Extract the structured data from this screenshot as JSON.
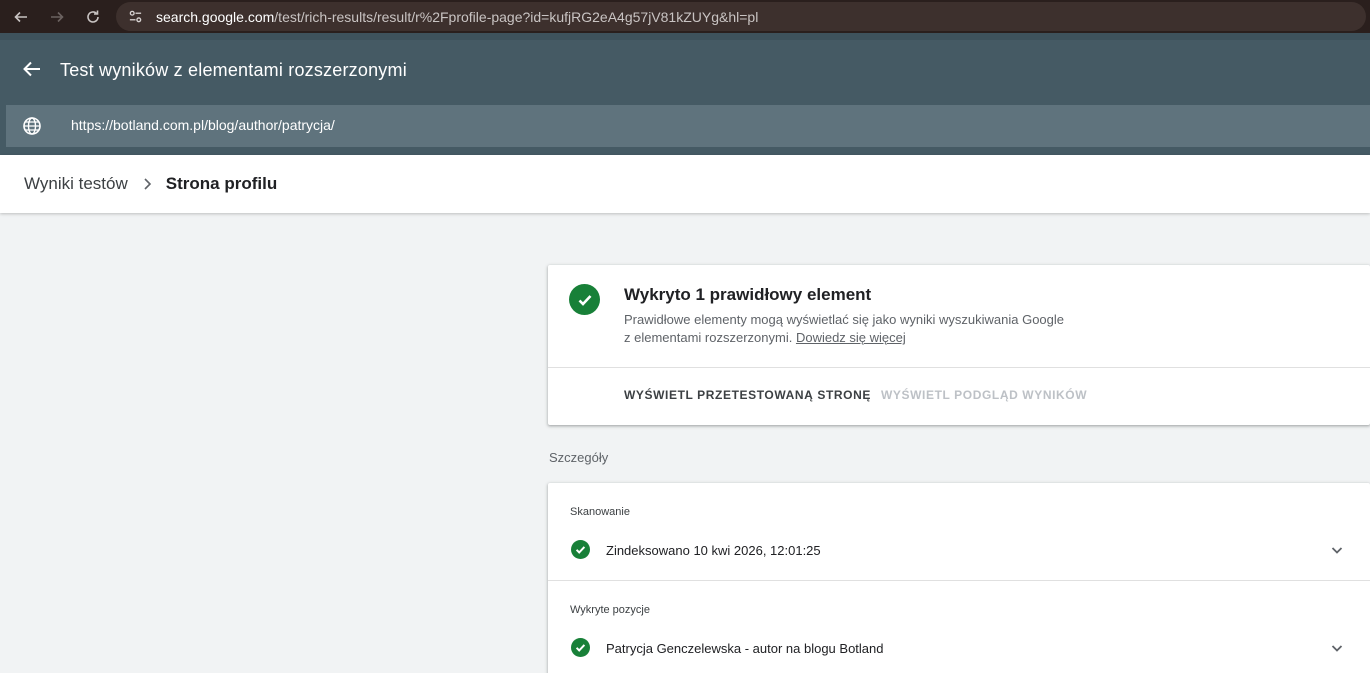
{
  "browser": {
    "url_host": "search.google.com",
    "url_path": "/test/rich-results/result/r%2Fprofile-page?id=kufjRG2eA4g57jV81kZUYg&hl=pl"
  },
  "header": {
    "title": "Test wyników z elementami rozszerzonymi",
    "tested_url": "https://botland.com.pl/blog/author/patrycja/"
  },
  "breadcrumb": {
    "parent": "Wyniki testów",
    "current": "Strona profilu"
  },
  "summary": {
    "title": "Wykryto 1 prawidłowy element",
    "description_line1": "Prawidłowe elementy mogą wyświetlać się jako wyniki wyszukiwania Google",
    "description_line2": "z elementami rozszerzonymi.",
    "learn_more": "Dowiedz się więcej",
    "view_tested_page": "WYŚWIETL PRZETESTOWANĄ STRONĘ",
    "view_preview": "WYŚWIETL PODGLĄD WYNIKÓW"
  },
  "details": {
    "label": "Szczegóły",
    "rows": [
      {
        "heading": "Skanowanie",
        "text": "Zindeksowano 10 kwi 2026, 12:01:25"
      },
      {
        "heading": "Wykryte pozycje",
        "text": "Patrycja Genczelewska - autor na blogu Botland"
      }
    ]
  },
  "colors": {
    "header_bg": "#455a64",
    "url_bar_bg": "#5f737d",
    "success_green": "#188038",
    "browser_bar_bg": "#2a1f1d"
  }
}
